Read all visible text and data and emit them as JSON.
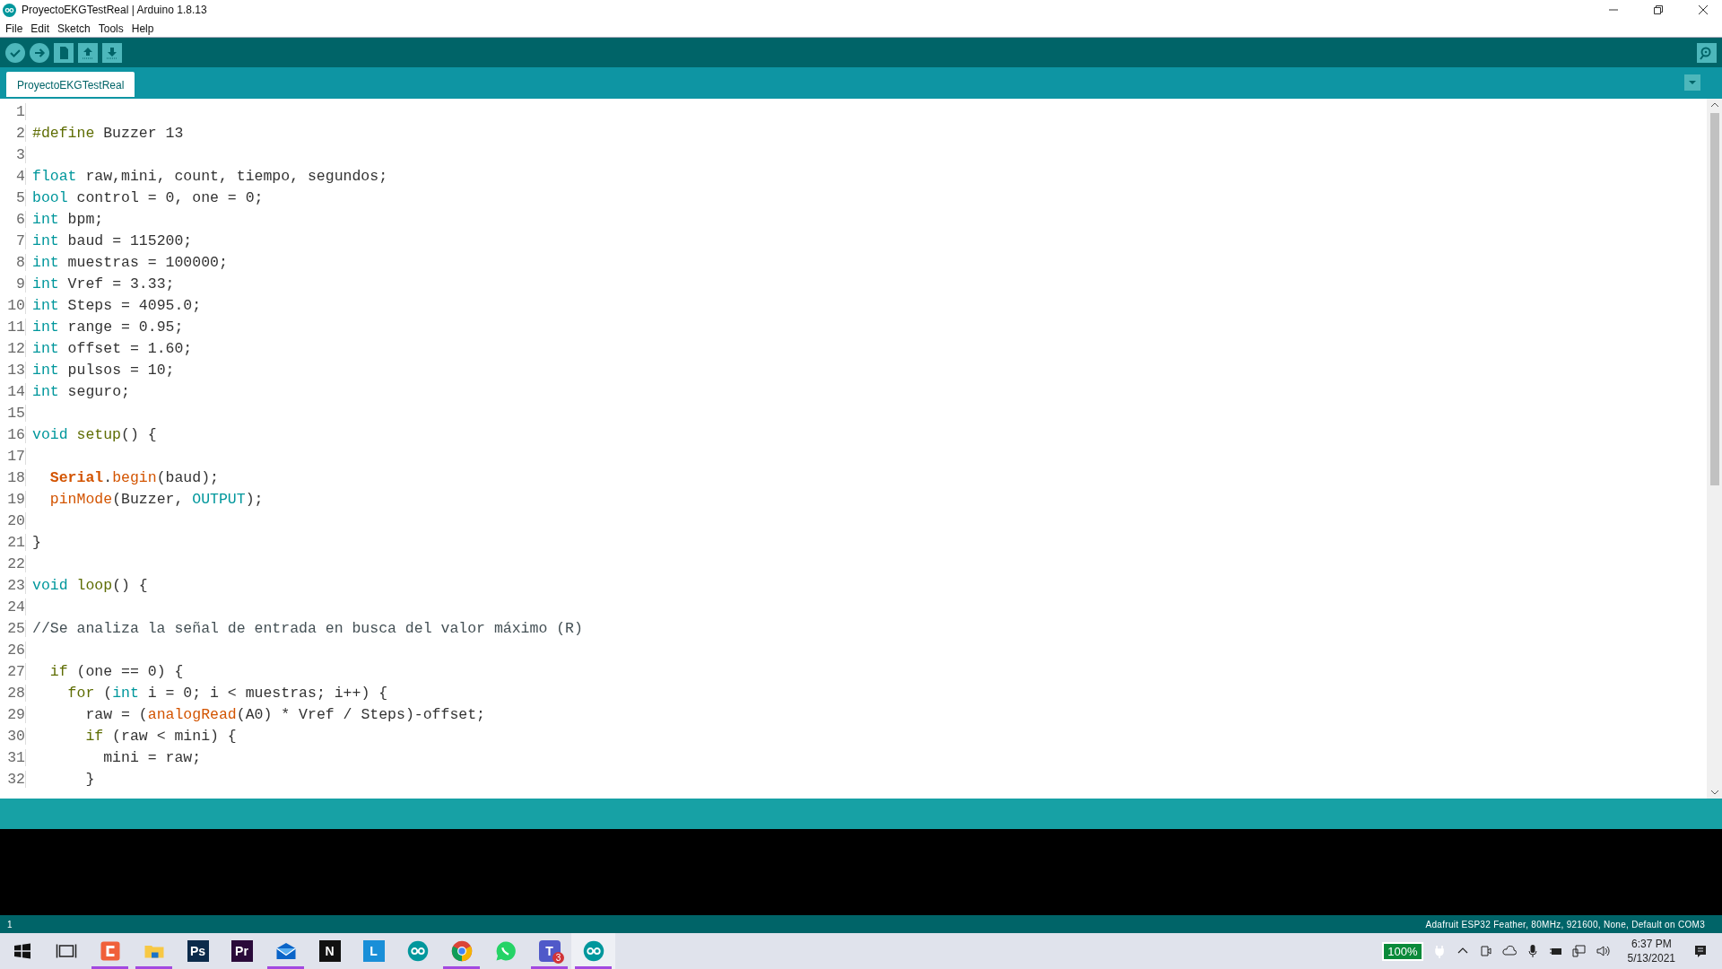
{
  "window": {
    "title": "ProyectoEKGTestReal | Arduino 1.8.13"
  },
  "menu": [
    "File",
    "Edit",
    "Sketch",
    "Tools",
    "Help"
  ],
  "tabs": [
    {
      "label": "ProyectoEKGTestReal",
      "selected": true
    }
  ],
  "editor": {
    "lines": [
      {
        "number": "1"
      },
      {
        "number": "2",
        "tokens": [
          {
            "text": "#define",
            "kind": "preprocessor"
          },
          {
            "text": " Buzzer 13",
            "kind": "plain"
          }
        ]
      },
      {
        "number": "3"
      },
      {
        "number": "4",
        "tokens": [
          {
            "text": "float",
            "kind": "type"
          },
          {
            "text": " raw,mini, count, tiempo, segundos;",
            "kind": "plain"
          }
        ]
      },
      {
        "number": "5",
        "tokens": [
          {
            "text": "bool",
            "kind": "type"
          },
          {
            "text": " control = 0, one = 0;",
            "kind": "plain"
          }
        ]
      },
      {
        "number": "6",
        "tokens": [
          {
            "text": "int",
            "kind": "type"
          },
          {
            "text": " bpm;",
            "kind": "plain"
          }
        ]
      },
      {
        "number": "7",
        "tokens": [
          {
            "text": "int",
            "kind": "type"
          },
          {
            "text": " baud = 115200;",
            "kind": "plain"
          }
        ]
      },
      {
        "number": "8",
        "tokens": [
          {
            "text": "int",
            "kind": "type"
          },
          {
            "text": " muestras = 100000;",
            "kind": "plain"
          }
        ]
      },
      {
        "number": "9",
        "tokens": [
          {
            "text": "int",
            "kind": "type"
          },
          {
            "text": " Vref = 3.33;",
            "kind": "plain"
          }
        ]
      },
      {
        "number": "10",
        "tokens": [
          {
            "text": "int",
            "kind": "type"
          },
          {
            "text": " Steps = 4095.0;",
            "kind": "plain"
          }
        ]
      },
      {
        "number": "11",
        "tokens": [
          {
            "text": "int",
            "kind": "type"
          },
          {
            "text": " range = 0.95;",
            "kind": "plain"
          }
        ]
      },
      {
        "number": "12",
        "tokens": [
          {
            "text": "int",
            "kind": "type"
          },
          {
            "text": " offset = 1.60;",
            "kind": "plain"
          }
        ]
      },
      {
        "number": "13",
        "tokens": [
          {
            "text": "int",
            "kind": "type"
          },
          {
            "text": " pulsos = 10;",
            "kind": "plain"
          }
        ]
      },
      {
        "number": "14",
        "tokens": [
          {
            "text": "int",
            "kind": "type"
          },
          {
            "text": " seguro;",
            "kind": "plain"
          }
        ]
      },
      {
        "number": "15"
      },
      {
        "number": "16",
        "tokens": [
          {
            "text": "void",
            "kind": "type"
          },
          {
            "text": " setup",
            "kind": "structure"
          },
          {
            "text": "() {",
            "kind": "plain"
          }
        ]
      },
      {
        "number": "17"
      },
      {
        "number": "18",
        "tokens": [
          {
            "text": "  Serial",
            "kind": "object"
          },
          {
            "text": ".",
            "kind": "plain"
          },
          {
            "text": "begin",
            "kind": "function"
          },
          {
            "text": "(baud);",
            "kind": "plain"
          }
        ]
      },
      {
        "number": "19",
        "tokens": [
          {
            "text": "  pinMode",
            "kind": "function"
          },
          {
            "text": "(Buzzer, ",
            "kind": "plain"
          },
          {
            "text": "OUTPUT",
            "kind": "constant"
          },
          {
            "text": ");",
            "kind": "plain"
          }
        ]
      },
      {
        "number": "20"
      },
      {
        "number": "21",
        "tokens": [
          {
            "text": "}",
            "kind": "plain"
          }
        ]
      },
      {
        "number": "22"
      },
      {
        "number": "23",
        "tokens": [
          {
            "text": "void",
            "kind": "type"
          },
          {
            "text": " loop",
            "kind": "structure"
          },
          {
            "text": "() {",
            "kind": "plain"
          }
        ]
      },
      {
        "number": "24"
      },
      {
        "number": "25",
        "tokens": [
          {
            "text": "//Se analiza la señal de entrada en busca del valor máximo (R)",
            "kind": "comment"
          }
        ]
      },
      {
        "number": "26"
      },
      {
        "number": "27",
        "tokens": [
          {
            "text": "  if",
            "kind": "structure"
          },
          {
            "text": " (one == 0) {",
            "kind": "plain"
          }
        ]
      },
      {
        "number": "28",
        "tokens": [
          {
            "text": "    for",
            "kind": "structure"
          },
          {
            "text": " (",
            "kind": "plain"
          },
          {
            "text": "int",
            "kind": "type"
          },
          {
            "text": " i = 0; i < muestras; i++) {",
            "kind": "plain"
          }
        ]
      },
      {
        "number": "29",
        "tokens": [
          {
            "text": "      raw = (",
            "kind": "plain"
          },
          {
            "text": "analogRead",
            "kind": "function"
          },
          {
            "text": "(A0) * Vref / Steps)-offset;",
            "kind": "plain"
          }
        ]
      },
      {
        "number": "30",
        "tokens": [
          {
            "text": "      if",
            "kind": "structure"
          },
          {
            "text": " (raw < mini) {",
            "kind": "plain"
          }
        ]
      },
      {
        "number": "31",
        "tokens": [
          {
            "text": "        mini = raw;",
            "kind": "plain"
          }
        ]
      },
      {
        "number": "32",
        "tokens": [
          {
            "text": "      }",
            "kind": "plain"
          }
        ]
      }
    ]
  },
  "status_bar": {
    "line": "1",
    "board": "Adafruit ESP32 Feather, 80MHz, 921600, None, Default on COM3"
  },
  "taskbar": {
    "items": [
      {
        "kind": "start",
        "running": false,
        "active": false
      },
      {
        "kind": "task-view",
        "running": false,
        "active": false
      },
      {
        "kind": "c-app",
        "running": true,
        "active": false
      },
      {
        "kind": "folder",
        "running": true,
        "active": false
      },
      {
        "kind": "tile",
        "label": "Ps",
        "color": "#0b2a4a",
        "running": false,
        "active": false
      },
      {
        "kind": "tile",
        "label": "Pr",
        "color": "#2a0a3a",
        "running": false,
        "active": false
      },
      {
        "kind": "mail",
        "running": true,
        "active": false
      },
      {
        "kind": "tile",
        "label": "N",
        "color": "#111111",
        "running": false,
        "active": false
      },
      {
        "kind": "tile",
        "label": "L",
        "color": "#1a8fd8",
        "running": false,
        "active": false
      },
      {
        "kind": "arduino",
        "running": false,
        "active": false
      },
      {
        "kind": "chrome",
        "running": true,
        "active": false
      },
      {
        "kind": "whatsapp",
        "running": false,
        "active": false
      },
      {
        "kind": "teams",
        "label": "T",
        "badge": "3",
        "running": true,
        "active": false
      },
      {
        "kind": "arduino",
        "running": true,
        "active": true
      }
    ],
    "battery": "100%",
    "time": "6:37 PM",
    "date": "5/13/2021"
  }
}
